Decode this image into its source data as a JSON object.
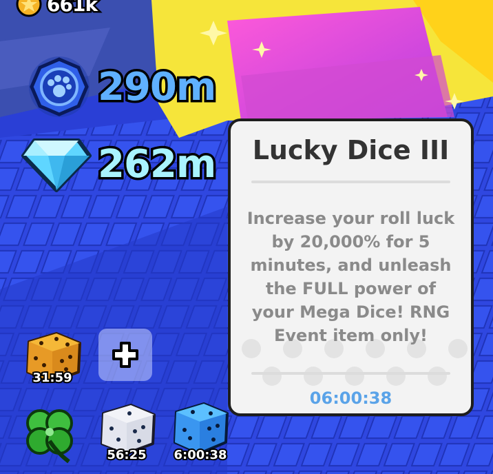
{
  "hud": {
    "top_currency": {
      "icon": "star-coin-icon",
      "amount": "661k"
    },
    "coins": {
      "icon": "paw-coin-icon",
      "amount": "290m"
    },
    "gems": {
      "icon": "diamond-icon",
      "amount": "262m"
    }
  },
  "tooltip": {
    "title": "Lucky Dice III",
    "description": "Increase your roll luck by 20,000% for 5 minutes, and unleash the FULL power of your Mega Dice! RNG Event item only!",
    "timer": "06:00:38"
  },
  "boosts": {
    "row1": [
      {
        "icon": "golden-dice-icon",
        "timer": "31:59"
      },
      {
        "icon": "plus-icon",
        "timer": ""
      }
    ],
    "row2": [
      {
        "icon": "four-leaf-clover-icon",
        "timer": ""
      },
      {
        "icon": "white-dice-icon",
        "timer": "56:25"
      },
      {
        "icon": "blue-dice-icon",
        "timer": "6:00:38"
      }
    ]
  },
  "colors": {
    "background": "#2a3fd6",
    "coins_text": "#5fb0ff",
    "gems_text": "#a9f3ff",
    "tooltip_timer": "#5aa3e8"
  }
}
